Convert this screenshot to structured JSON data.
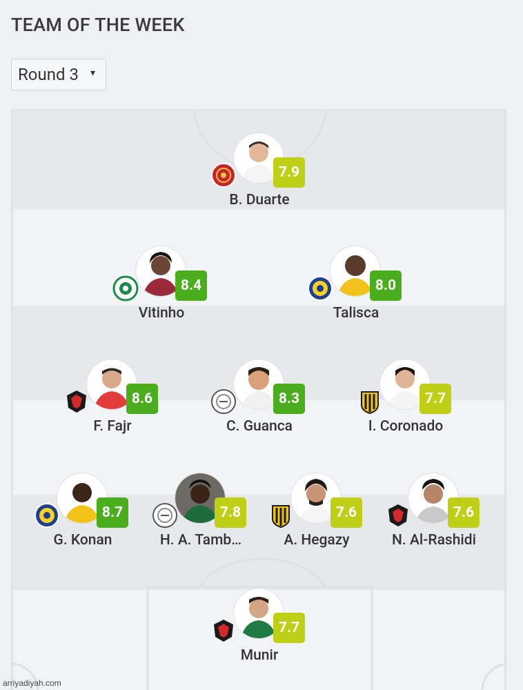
{
  "header": {
    "title": "TEAM OF THE WEEK"
  },
  "round_select": {
    "value": "Round 3",
    "caret": "▾"
  },
  "colors": {
    "rating_green": "#4aad1b",
    "rating_yellow_green": "#bfcf16",
    "pitch_light": "#f2f3f6",
    "pitch_dark": "#e6e8ec"
  },
  "players": [
    {
      "name": "B. Duarte",
      "rating": "7.9",
      "tier": "yellow_green",
      "club_icon": "red-round-club-crest-icon"
    },
    {
      "name": "Vitinho",
      "rating": "8.4",
      "tier": "green",
      "club_icon": "green-white-club-crest-icon"
    },
    {
      "name": "Talisca",
      "rating": "8.0",
      "tier": "green",
      "club_icon": "blue-yellow-club-crest-icon"
    },
    {
      "name": "F. Fajr",
      "rating": "8.6",
      "tier": "green",
      "club_icon": "red-black-eagle-crest-icon"
    },
    {
      "name": "C. Guanca",
      "rating": "8.3",
      "tier": "green",
      "club_icon": "white-grey-club-crest-icon"
    },
    {
      "name": "I. Coronado",
      "rating": "7.7",
      "tier": "yellow_green",
      "club_icon": "yellow-black-striped-crest-icon"
    },
    {
      "name": "G. Konan",
      "rating": "8.7",
      "tier": "green",
      "club_icon": "blue-yellow-club-crest-icon"
    },
    {
      "name": "H. A. Tamb…",
      "rating": "7.8",
      "tier": "yellow_green",
      "club_icon": "white-grey-club-crest-icon"
    },
    {
      "name": "A. Hegazy",
      "rating": "7.6",
      "tier": "yellow_green",
      "club_icon": "yellow-black-striped-crest-icon"
    },
    {
      "name": "N. Al-Rashidi",
      "rating": "7.6",
      "tier": "yellow_green",
      "club_icon": "red-black-eagle-crest-icon"
    },
    {
      "name": "Munir",
      "rating": "7.7",
      "tier": "yellow_green",
      "club_icon": "red-black-eagle-crest-icon"
    }
  ],
  "watermark": "arriyadiyah.com"
}
